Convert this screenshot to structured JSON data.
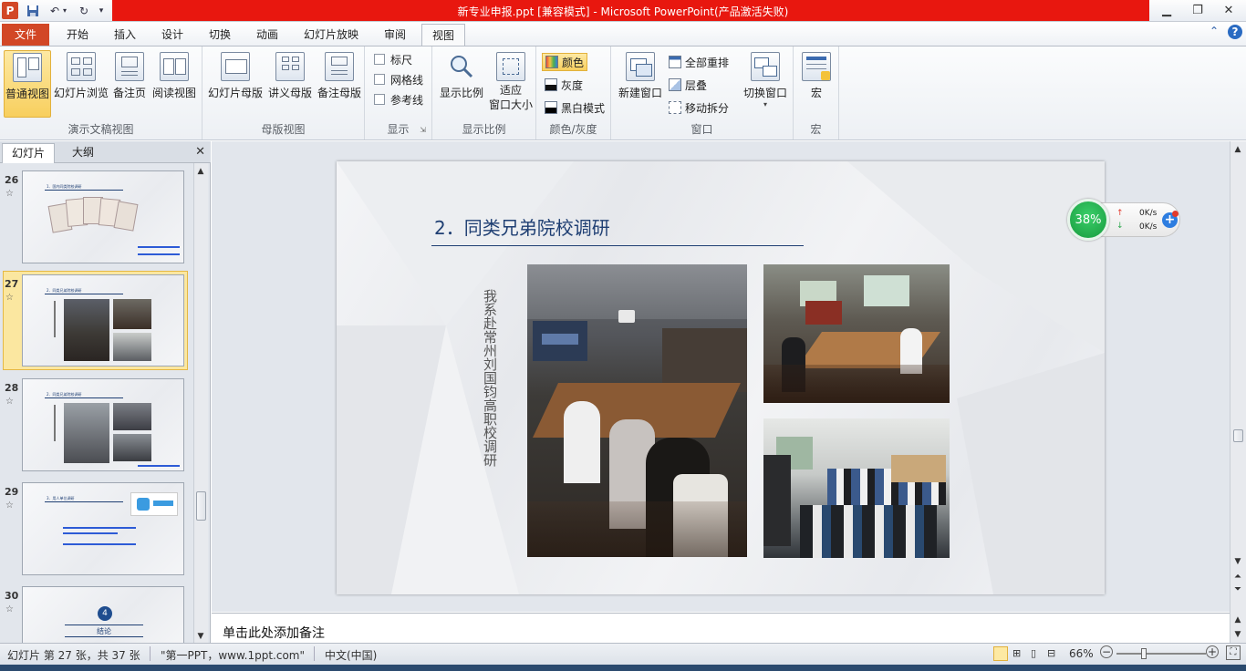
{
  "window": {
    "title": "新专业申报.ppt [兼容模式]  -  Microsoft PowerPoint(产品激活失败)"
  },
  "ribbon_tabs": [
    "文件",
    "开始",
    "插入",
    "设计",
    "切换",
    "动画",
    "幻灯片放映",
    "审阅",
    "视图"
  ],
  "active_tab": "视图",
  "ribbon": {
    "presentation_views": {
      "label": "演示文稿视图",
      "buttons": [
        "普通视图",
        "幻灯片浏览",
        "备注页",
        "阅读视图"
      ]
    },
    "master_views": {
      "label": "母版视图",
      "buttons": [
        "幻灯片母版",
        "讲义母版",
        "备注母版"
      ]
    },
    "show": {
      "label": "显示",
      "checkboxes": [
        "标尺",
        "网格线",
        "参考线"
      ]
    },
    "zoom": {
      "label": "显示比例",
      "buttons": [
        "显示比例",
        "适应",
        "窗口大小"
      ]
    },
    "color": {
      "label": "颜色/灰度",
      "buttons": [
        "颜色",
        "灰度",
        "黑白模式"
      ]
    },
    "window": {
      "label": "窗口",
      "big": "新建窗口",
      "small": [
        "全部重排",
        "层叠",
        "移动拆分"
      ],
      "switch": "切换窗口"
    },
    "macro": {
      "label": "宏",
      "button": "宏"
    }
  },
  "left_pane": {
    "tabs": [
      "幻灯片",
      "大纲"
    ],
    "close": "✕",
    "slides": [
      {
        "num": "26",
        "title": "1．国内同类院校调研"
      },
      {
        "num": "27",
        "title": "2．同类兄弟院校调研",
        "selected": true
      },
      {
        "num": "28",
        "title": "2．同类兄弟院校调研"
      },
      {
        "num": "29",
        "title": "3．用人单位调研"
      },
      {
        "num": "30",
        "badge": "4",
        "caption": "结论"
      }
    ]
  },
  "slide": {
    "title": "2．同类兄弟院校调研",
    "vertical_text": "我系赴常州刘国钧高职校调研"
  },
  "notes": {
    "placeholder": "单击此处添加备注"
  },
  "speed_widget": {
    "percent": "38%",
    "up": "0K/s",
    "down": "0K/s"
  },
  "status_bar": {
    "slide_info": "幻灯片 第 27 张，共 37 张",
    "theme": "\"第一PPT，www.1ppt.com\"",
    "language": "中文(中国)",
    "zoom": "66%",
    "zoom_fraction": 0.66
  },
  "colors": {
    "title_red": "#e8170f",
    "file_tab": "#d24726",
    "slide_title": "#1f3f73",
    "selected_gold": "#f8cf5e"
  }
}
